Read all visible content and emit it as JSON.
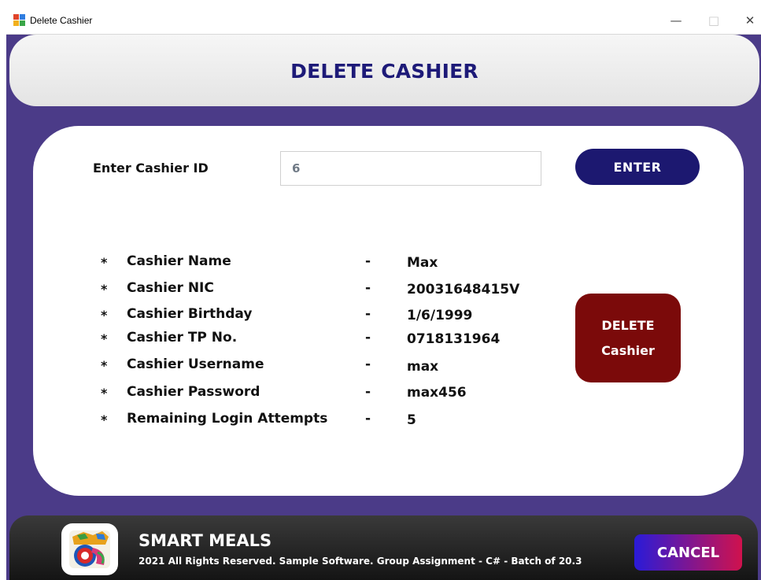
{
  "window": {
    "title": "Delete Cashier",
    "controls": {
      "minimize": "—",
      "maximize": "□",
      "close": "✕"
    }
  },
  "header": {
    "heading": "DELETE CASHIER"
  },
  "lookup": {
    "label": "Enter Cashier ID",
    "value": "6",
    "enter_label": "ENTER"
  },
  "details": [
    {
      "bullet": "*",
      "label": "Cashier Name",
      "dash": "-",
      "value": "Max"
    },
    {
      "bullet": "*",
      "label": "Cashier NIC",
      "dash": "-",
      "value": "20031648415V"
    },
    {
      "bullet": "*",
      "label": "Cashier Birthday",
      "dash": "-",
      "value": "1/6/1999"
    },
    {
      "bullet": "*",
      "label": "Cashier TP No.",
      "dash": "-",
      "value": "0718131964"
    },
    {
      "bullet": "*",
      "label": "Cashier Username",
      "dash": "-",
      "value": "max"
    },
    {
      "bullet": "*",
      "label": "Cashier Password",
      "dash": "-",
      "value": "max456"
    },
    {
      "bullet": "*",
      "label": "Remaining Login Attempts",
      "dash": "-",
      "value": "5"
    }
  ],
  "delete_button": {
    "line1": "DELETE",
    "line2": "Cashier"
  },
  "footer": {
    "brand": "SMART MEALS",
    "copyright": "2021 All Rights Reserved.  Sample Software. Group Assignment - C# - Batch of 20.3",
    "cancel_label": "CANCEL",
    "logo_icon": "smart-meals-logo-icon"
  },
  "colors": {
    "background": "#4b3b88",
    "heading": "#1d1a78",
    "enter_button": "#1c1870",
    "delete_button": "#7b0a0a",
    "cancel_gradient_start": "#2a1bd8",
    "cancel_gradient_end": "#d0124d"
  }
}
